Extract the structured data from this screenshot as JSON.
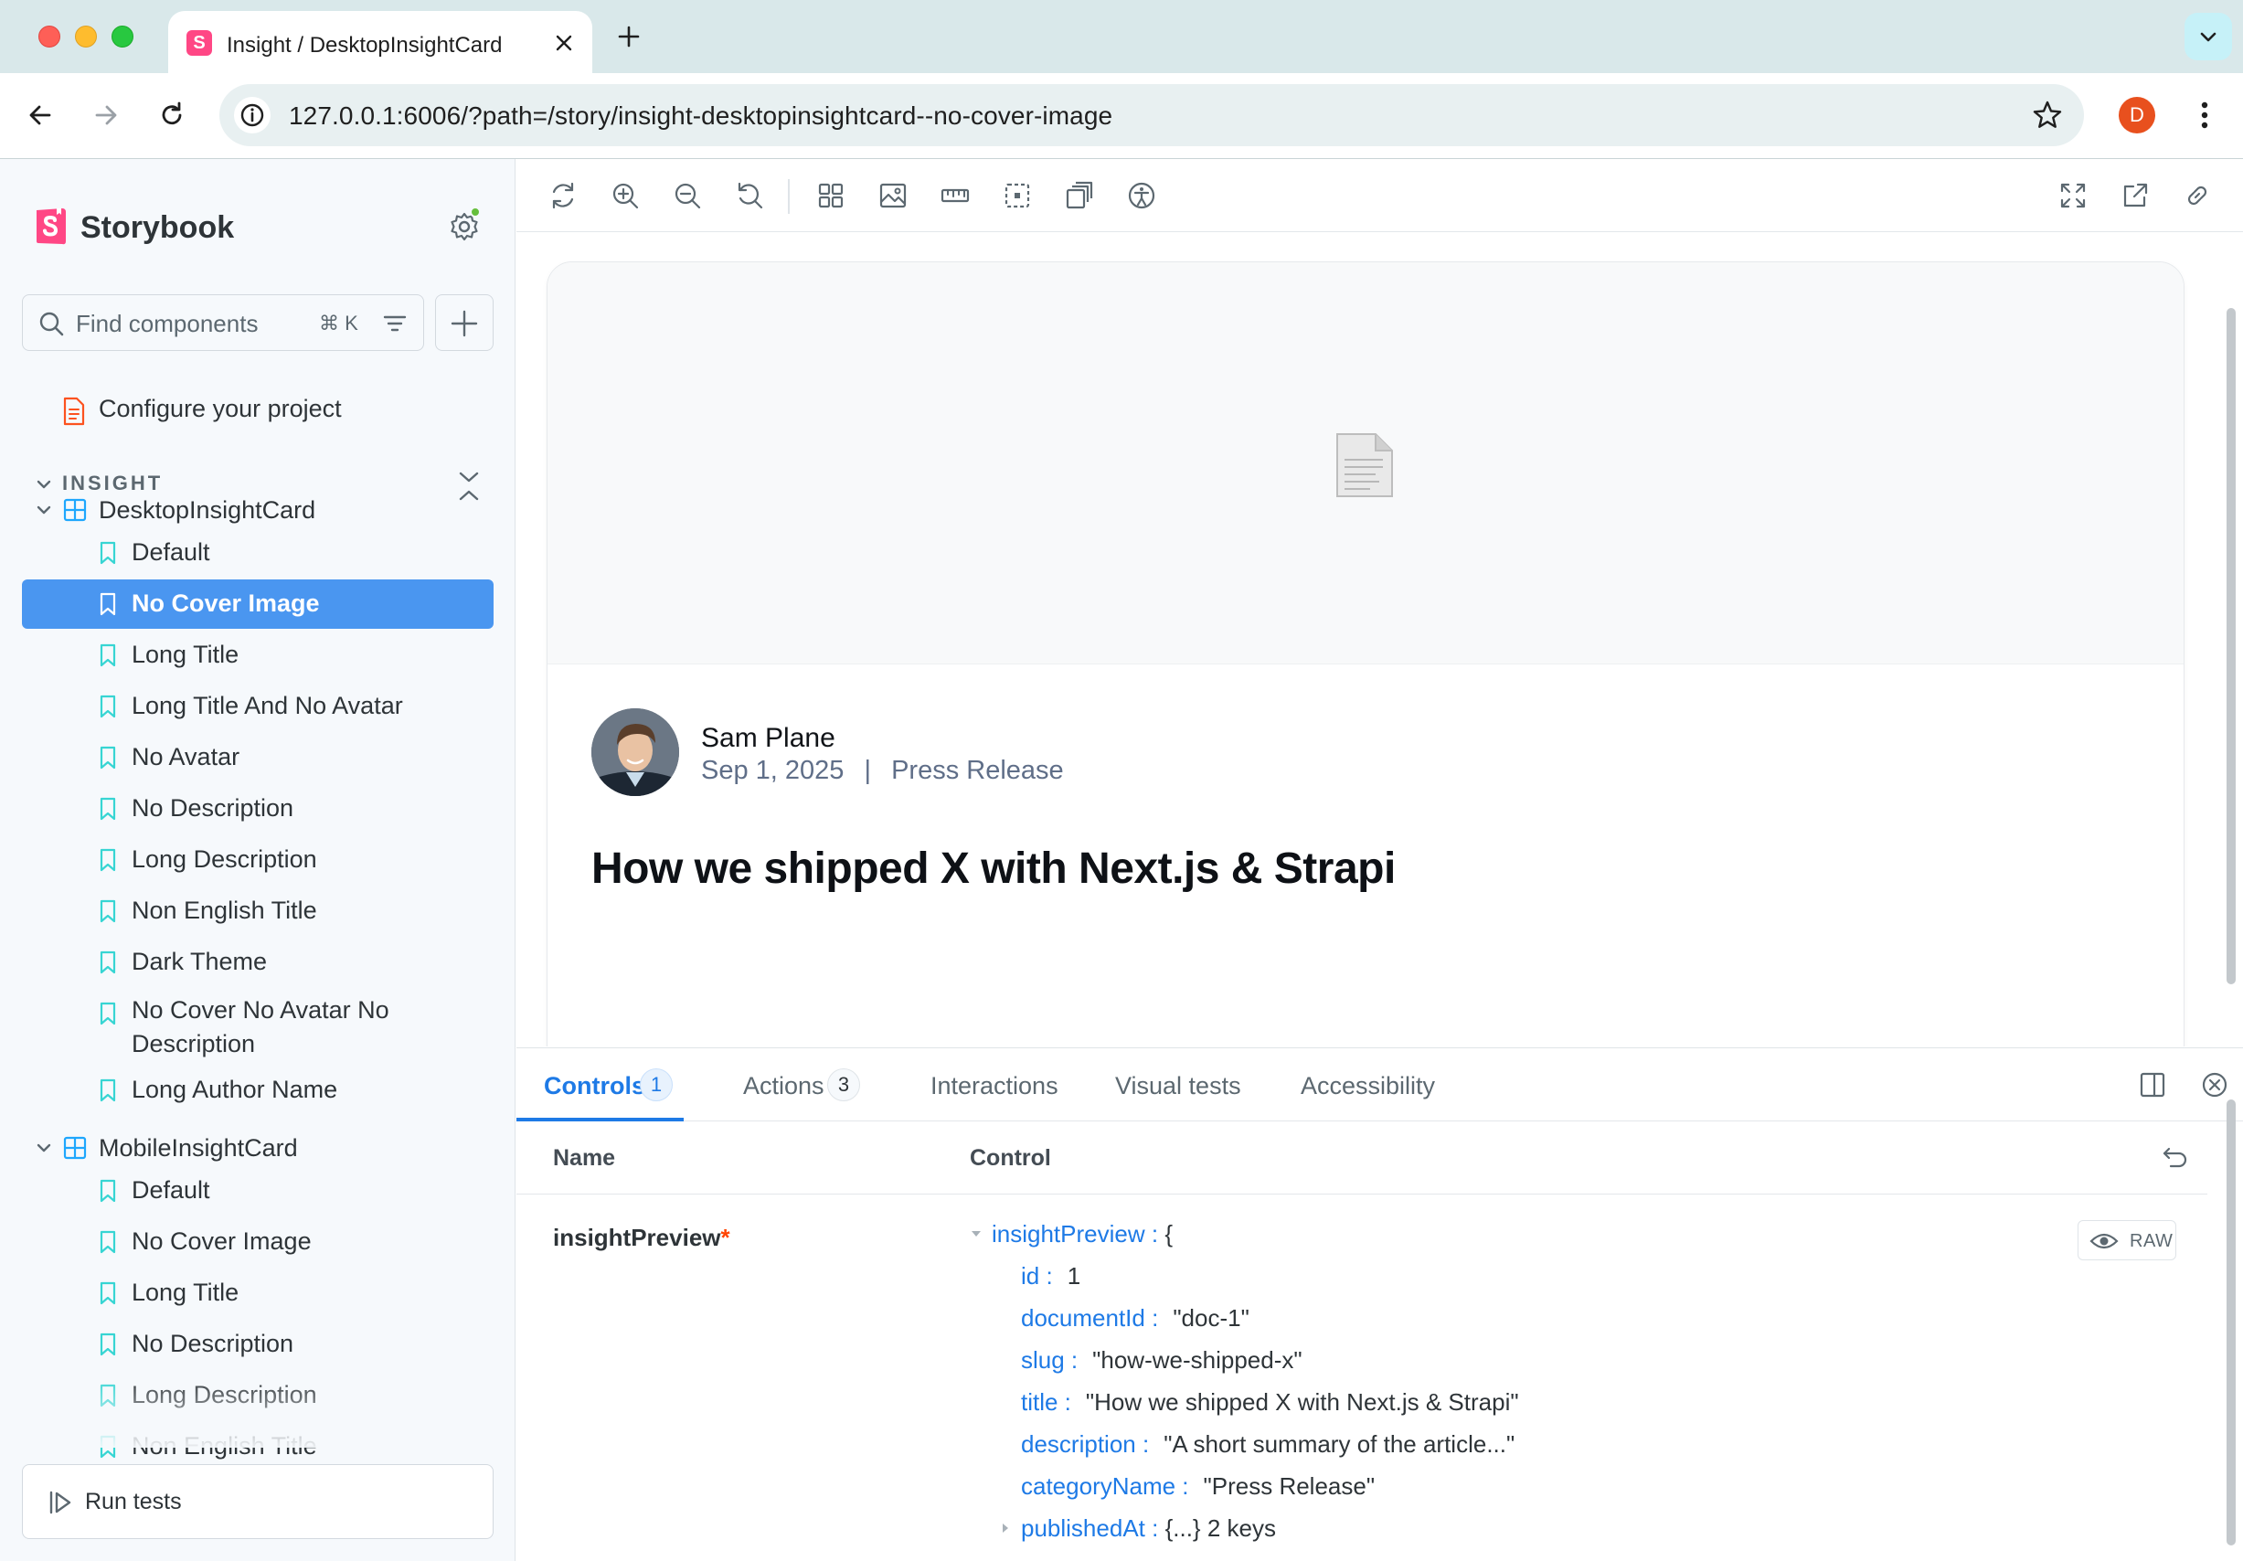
{
  "browser": {
    "tab_title": "Insight / DesktopInsightCard",
    "url": "127.0.0.1:6006/?path=/story/insight-desktopinsightcard--no-cover-image",
    "profile_initial": "D"
  },
  "sidebar": {
    "brand": "Storybook",
    "search_placeholder": "Find components",
    "search_shortcut": "⌘ K",
    "configure_label": "Configure your project",
    "section_label": "INSIGHT",
    "components": [
      {
        "name": "DesktopInsightCard",
        "stories": [
          "Default",
          "No Cover Image",
          "Long Title",
          "Long Title And No Avatar",
          "No Avatar",
          "No Description",
          "Long Description",
          "Non English Title",
          "Dark Theme",
          "No Cover No Avatar No Description",
          "Long Author Name"
        ]
      },
      {
        "name": "MobileInsightCard",
        "stories": [
          "Default",
          "No Cover Image",
          "Long Title",
          "No Description",
          "Long Description",
          "Non English Title"
        ]
      }
    ],
    "selected_story": "No Cover Image",
    "run_tests_label": "Run tests"
  },
  "preview": {
    "author_name": "Sam Plane",
    "date": "Sep 1, 2025",
    "separator": "|",
    "category": "Press Release",
    "title": "How we shipped X with Next.js & Strapi"
  },
  "addons": {
    "tabs": [
      {
        "label": "Controls",
        "badge": "1",
        "active": true
      },
      {
        "label": "Actions",
        "badge": "3",
        "active": false
      },
      {
        "label": "Interactions",
        "badge": "",
        "active": false
      },
      {
        "label": "Visual tests",
        "badge": "",
        "active": false
      },
      {
        "label": "Accessibility",
        "badge": "",
        "active": false
      }
    ],
    "columns": {
      "name": "Name",
      "control": "Control"
    },
    "prop": {
      "name": "insightPreview",
      "required_marker": "*"
    },
    "raw_label": "RAW",
    "json": {
      "root_key": "insightPreview :",
      "root_open": "{",
      "fields": [
        {
          "key": "id :",
          "value": "1"
        },
        {
          "key": "documentId :",
          "value": "\"doc-1\""
        },
        {
          "key": "slug :",
          "value": "\"how-we-shipped-x\""
        },
        {
          "key": "title :",
          "value": "\"How we shipped X with Next.js & Strapi\""
        },
        {
          "key": "description :",
          "value": "\"A short summary of the article...\""
        },
        {
          "key": "categoryName :",
          "value": "\"Press Release\""
        }
      ],
      "collapsed_key": "publishedAt :",
      "collapsed_value": "{...} 2 keys"
    }
  },
  "colors": {
    "accent": "#1e7ae6",
    "selected_bg": "#4a96f0",
    "storybook_pink": "#ff4785",
    "story_icon": "#37d5d3",
    "component_icon": "#1ea7fd",
    "doc_icon": "#fc521f"
  }
}
